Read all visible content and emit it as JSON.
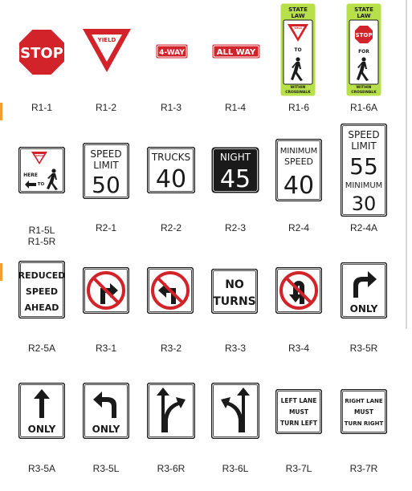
{
  "colors": {
    "red": "#d2232a",
    "black": "#1a1a1a",
    "white": "#ffffff",
    "lime": "#b8e04a"
  },
  "signs": {
    "r1_1": {
      "code": "R1-1",
      "text": "STOP"
    },
    "r1_2": {
      "code": "R1-2",
      "text": "YIELD"
    },
    "r1_3": {
      "code": "R1-3",
      "text": "4-WAY"
    },
    "r1_4": {
      "code": "R1-4",
      "text": "ALL WAY"
    },
    "r1_6": {
      "code": "R1-6",
      "line1": "STATE",
      "line2": "LAW",
      "yield": "YIELD",
      "to": "TO",
      "within1": "WITHIN",
      "within2": "CROSSWALK"
    },
    "r1_6a": {
      "code": "R1-6A",
      "line1": "STATE",
      "line2": "LAW",
      "stop": "STOP",
      "for": "FOR",
      "within1": "WITHIN",
      "within2": "CROSSWALK"
    },
    "r1_5": {
      "code1": "R1-5L",
      "code2": "R1-5R",
      "yield": "YIELD",
      "here": "HERE",
      "to": "TO"
    },
    "r2_1": {
      "code": "R2-1",
      "line1": "SPEED",
      "line2": "LIMIT",
      "value": "50"
    },
    "r2_2": {
      "code": "R2-2",
      "line1": "TRUCKS",
      "value": "40"
    },
    "r2_3": {
      "code": "R2-3",
      "line1": "NIGHT",
      "value": "45"
    },
    "r2_4": {
      "code": "R2-4",
      "line1": "MINIMUM",
      "line2": "SPEED",
      "value": "40"
    },
    "r2_4a": {
      "code": "R2-4A",
      "line1": "SPEED",
      "line2": "LIMIT",
      "value": "55",
      "line3": "MINIMUM",
      "value2": "30"
    },
    "r2_5a": {
      "code": "R2-5A",
      "line1": "REDUCED",
      "line2": "SPEED",
      "line3": "AHEAD"
    },
    "r3_1": {
      "code": "R3-1"
    },
    "r3_2": {
      "code": "R3-2"
    },
    "r3_3": {
      "code": "R3-3",
      "line1": "NO",
      "line2": "TURNS"
    },
    "r3_4": {
      "code": "R3-4"
    },
    "r3_5r": {
      "code": "R3-5R",
      "only": "ONLY"
    },
    "r3_5a": {
      "code": "R3-5A",
      "only": "ONLY"
    },
    "r3_5l": {
      "code": "R3-5L",
      "only": "ONLY"
    },
    "r3_6r": {
      "code": "R3-6R"
    },
    "r3_6l": {
      "code": "R3-6L"
    },
    "r3_7l": {
      "code": "R3-7L",
      "line1": "LEFT LANE",
      "line2": "MUST",
      "line3": "TURN LEFT"
    },
    "r3_7r": {
      "code": "R3-7R",
      "line1": "RIGHT LANE",
      "line2": "MUST",
      "line3": "TURN RIGHT"
    }
  }
}
